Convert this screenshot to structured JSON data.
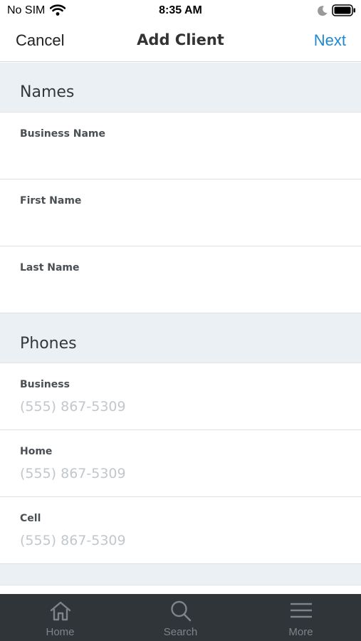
{
  "status_bar": {
    "carrier": "No SIM",
    "time": "8:35 AM"
  },
  "nav": {
    "cancel_label": "Cancel",
    "title": "Add Client",
    "next_label": "Next"
  },
  "sections": {
    "names": {
      "title": "Names",
      "fields": [
        {
          "label": "Business Name",
          "value": "",
          "placeholder": ""
        },
        {
          "label": "First Name",
          "value": "",
          "placeholder": ""
        },
        {
          "label": "Last Name",
          "value": "",
          "placeholder": ""
        }
      ]
    },
    "phones": {
      "title": "Phones",
      "fields": [
        {
          "label": "Business",
          "value": "",
          "placeholder": "(555) 867-5309"
        },
        {
          "label": "Home",
          "value": "",
          "placeholder": "(555) 867-5309"
        },
        {
          "label": "Cell",
          "value": "",
          "placeholder": "(555) 867-5309"
        }
      ]
    }
  },
  "tab_bar": {
    "items": [
      {
        "label": "Home",
        "icon": "home-icon"
      },
      {
        "label": "Search",
        "icon": "search-icon"
      },
      {
        "label": "More",
        "icon": "menu-icon"
      }
    ]
  },
  "colors": {
    "accent": "#1e8ad0",
    "tab_bar_bg": "#2f3538",
    "section_bg": "#eaf0f3"
  }
}
